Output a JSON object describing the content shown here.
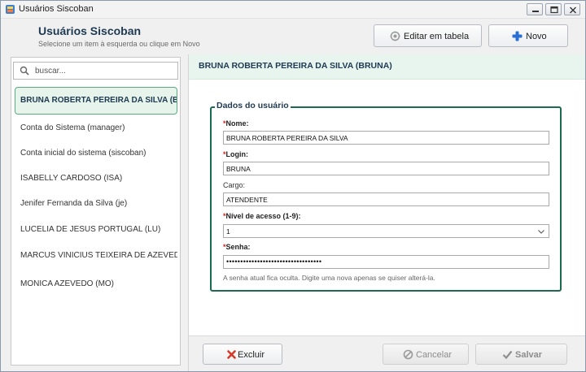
{
  "window": {
    "title": "Usuários Siscoban"
  },
  "header": {
    "title": "Usuários Siscoban",
    "subtitle": "Selecione um item à esquerda ou clique em Novo",
    "edit_table_label": "Editar em tabela",
    "new_label": "Novo"
  },
  "sidebar": {
    "search_placeholder": "buscar...",
    "items": [
      {
        "label": "BRUNA ROBERTA PEREIRA DA SILVA (BRUNA)",
        "selected": true
      },
      {
        "label": "Conta do Sistema (manager)"
      },
      {
        "label": "Conta inicial do sistema (siscoban)"
      },
      {
        "label": "ISABELLY CARDOSO (ISA)"
      },
      {
        "label": "Jenifer Fernanda da Silva (je)"
      },
      {
        "label": "LUCELIA DE JESUS PORTUGAL (LU)"
      },
      {
        "label": "MARCUS VINICIUS TEIXEIRA DE AZEVEDO"
      },
      {
        "label": "MONICA AZEVEDO (MO)"
      }
    ]
  },
  "detail": {
    "banner": "BRUNA ROBERTA PEREIRA DA SILVA (BRUNA)",
    "section_title": "Dados do usuário",
    "fields": {
      "nome_label": "Nome:",
      "nome_value": "BRUNA ROBERTA PEREIRA DA SILVA",
      "login_label": "Login:",
      "login_value": "BRUNA",
      "cargo_label": "Cargo:",
      "cargo_value": "ATENDENTE",
      "nivel_label": "Nível de acesso (1-9):",
      "nivel_value": "1",
      "senha_label": "Senha:",
      "senha_value": "••••••••••••••••••••••••••••••••••"
    },
    "hint": "A senha atual fica oculta. Digite uma nova apenas se quiser alterá-la.",
    "required_mark": "*"
  },
  "footer": {
    "delete_label": "Excluir",
    "cancel_label": "Cancelar",
    "save_label": "Salvar"
  },
  "colors": {
    "accent_green": "#1c6a50",
    "selection_bg": "#e6f4ec",
    "required_red": "#d21f1f",
    "new_icon_blue": "#2a6fd6",
    "delete_icon_red": "#d23a2a"
  }
}
